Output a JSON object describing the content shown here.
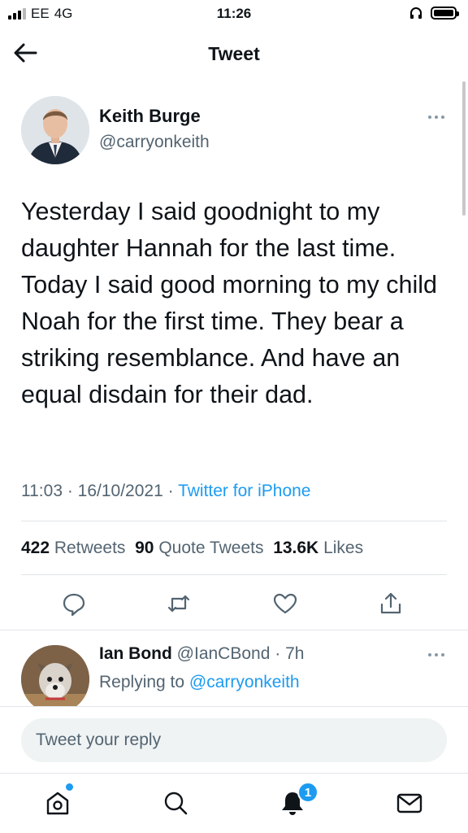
{
  "status_bar": {
    "carrier": "EE",
    "network": "4G",
    "time": "11:26"
  },
  "header": {
    "title": "Tweet"
  },
  "tweet": {
    "author_name": "Keith Burge",
    "author_handle": "@carryonkeith",
    "text": "Yesterday I said goodnight to my daughter Hannah for the last time. Today I said good morning to my child Noah for the first time. They bear a striking resemblance. And have an equal disdain for their dad.",
    "time": "11:03",
    "date": "16/10/2021",
    "source": "Twitter for iPhone",
    "stats": {
      "retweets_count": "422",
      "retweets_label": "Retweets",
      "quotes_count": "90",
      "quotes_label": "Quote Tweets",
      "likes_count": "13.6K",
      "likes_label": "Likes"
    }
  },
  "reply": {
    "author_name": "Ian Bond",
    "author_handle": "@IanCBond",
    "age": "7h",
    "replying_label": "Replying to",
    "replying_to": "@carryonkeith"
  },
  "compose": {
    "placeholder": "Tweet your reply"
  },
  "tabbar": {
    "notifications_badge": "1"
  },
  "colors": {
    "accent": "#1d9bf0",
    "text": "#0f1419",
    "muted": "#536471"
  },
  "icons": [
    "back-arrow-icon",
    "reply-icon",
    "retweet-icon",
    "like-icon",
    "share-icon",
    "home-icon",
    "search-icon",
    "notifications-icon",
    "messages-icon",
    "more-icon",
    "headphones-icon",
    "battery-icon",
    "signal-icon"
  ]
}
